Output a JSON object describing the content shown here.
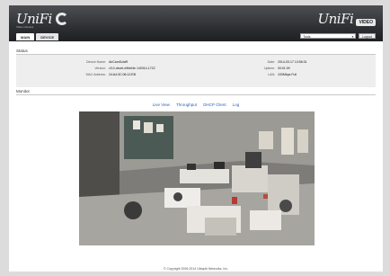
{
  "header": {
    "brand_left": "UniFi",
    "brand_left_sub": "Video Camera",
    "brand_right": "UniFi",
    "brand_right_badge": "VIDEO",
    "tabs": [
      {
        "label": "MAIN"
      },
      {
        "label": "DEVICE"
      }
    ],
    "tools_select": "Tools",
    "logout": "Logout"
  },
  "status": {
    "title": "Status",
    "left": [
      {
        "label": "Device Name:",
        "value": "AirCamSolaR"
      },
      {
        "label": "Version:",
        "value": "v3.0-devel-e9bbf4e 140314-1722"
      },
      {
        "label": "MAC Address:",
        "value": "24:A4:3C:06:12:EB"
      }
    ],
    "right": [
      {
        "label": "Date:",
        "value": "2014-03-17 13:56:31"
      },
      {
        "label": "Uptime:",
        "value": "00:01:09"
      },
      {
        "label": "LAN:",
        "value": "100Mbps Full"
      }
    ]
  },
  "monitor": {
    "title": "Monitor",
    "links": [
      "Live View",
      "Throughput",
      "DHCP Client",
      "Log"
    ]
  },
  "footer": "© Copyright 2006-2014 Ubiquiti Networks, Inc.",
  "colors": {
    "accent": "#2d63b6",
    "header": "#2e3033"
  }
}
